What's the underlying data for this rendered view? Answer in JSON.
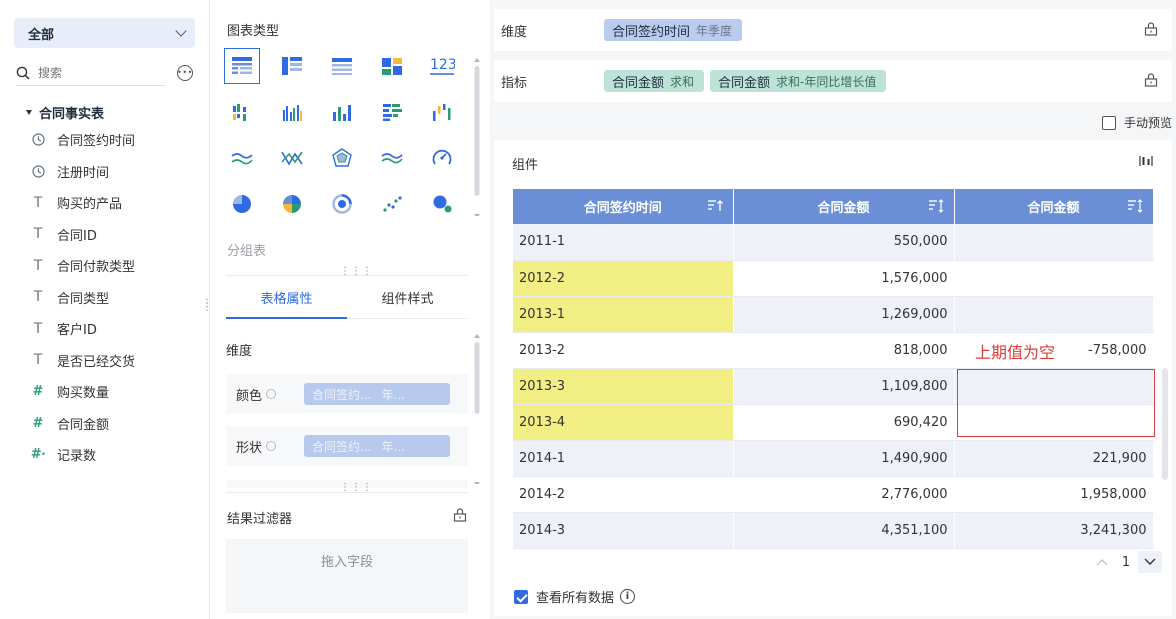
{
  "left": {
    "dataset_selected": "全部",
    "search_placeholder": "搜索",
    "table_name": "合同事实表",
    "fields": [
      {
        "name": "合同签约时间",
        "icon": "clock-icon",
        "type": "date"
      },
      {
        "name": "注册时间",
        "icon": "clock-icon",
        "type": "date"
      },
      {
        "name": "购买的产品",
        "icon": "text-field-icon",
        "type": "text"
      },
      {
        "name": "合同ID",
        "icon": "text-field-icon",
        "type": "text"
      },
      {
        "name": "合同付款类型",
        "icon": "text-field-icon",
        "type": "text"
      },
      {
        "name": "合同类型",
        "icon": "text-field-icon",
        "type": "text"
      },
      {
        "name": "客户ID",
        "icon": "text-field-icon",
        "type": "text"
      },
      {
        "name": "是否已经交货",
        "icon": "text-field-icon",
        "type": "text"
      },
      {
        "name": "购买数量",
        "icon": "number-field-icon",
        "type": "number"
      },
      {
        "name": "合同金额",
        "icon": "number-field-icon",
        "type": "number"
      },
      {
        "name": "记录数",
        "icon": "calc-number-field-icon",
        "type": "number"
      }
    ]
  },
  "config": {
    "chart_type_title": "图表类型",
    "group_table_label": "分组表",
    "tabs": [
      {
        "label": "表格属性",
        "active": true
      },
      {
        "label": "组件样式",
        "active": false
      }
    ],
    "dimension_label": "维度",
    "properties": [
      {
        "label": "颜色",
        "pill_a": "合同签约...",
        "pill_b": "年..."
      },
      {
        "label": "形状",
        "pill_a": "合同签约...",
        "pill_b": "年..."
      }
    ],
    "result_filter_title": "结果过滤器",
    "filter_drop_hint": "拖入字段"
  },
  "shelves": {
    "dimension": {
      "label": "维度",
      "pills": [
        {
          "name": "合同签约时间",
          "sub": "年季度"
        }
      ]
    },
    "measure": {
      "label": "指标",
      "pills": [
        {
          "name": "合同金额",
          "sub": "求和"
        },
        {
          "name": "合同金额",
          "sub": "求和-年同比增长值"
        }
      ]
    }
  },
  "manual_preview_label": "手动预览",
  "widget": {
    "title": "组件",
    "columns": [
      "合同签约时间",
      "合同金额",
      "合同金额"
    ],
    "rows": [
      {
        "period": "2011-1",
        "amount": "550,000",
        "growth": "",
        "highlight": false
      },
      {
        "period": "2012-2",
        "amount": "1,576,000",
        "growth": "",
        "highlight": true
      },
      {
        "period": "2013-1",
        "amount": "1,269,000",
        "growth": "",
        "highlight": true
      },
      {
        "period": "2013-2",
        "amount": "818,000",
        "growth": "-758,000",
        "highlight": false
      },
      {
        "period": "2013-3",
        "amount": "1,109,800",
        "growth": "",
        "highlight": true
      },
      {
        "period": "2013-4",
        "amount": "690,420",
        "growth": "",
        "highlight": true
      },
      {
        "period": "2014-1",
        "amount": "1,490,900",
        "growth": "221,900",
        "highlight": false
      },
      {
        "period": "2014-2",
        "amount": "2,776,000",
        "growth": "1,958,000",
        "highlight": false
      },
      {
        "period": "2014-3",
        "amount": "4,351,100",
        "growth": "3,241,300",
        "highlight": false
      }
    ],
    "annotation": "上期值为空",
    "page": "1",
    "view_all_label": "查看所有数据"
  },
  "colors": {
    "accent": "#2f6be0",
    "header_bg": "#6a8fd6",
    "highlight": "#f1ee84",
    "annotation": "#e23b3b",
    "dim_pill": "#b9cbee",
    "measure_pill": "#bde3d8"
  }
}
